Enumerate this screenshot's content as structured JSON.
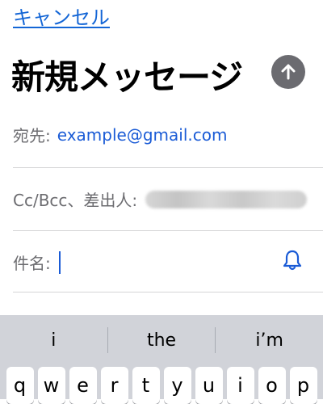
{
  "header": {
    "cancel_label": "キャンセル",
    "title": "新規メッセージ"
  },
  "fields": {
    "to_label": "宛先:",
    "to_value": "example@gmail.com",
    "cc_label": "Cc/Bcc、差出人:",
    "subject_label": "件名:"
  },
  "keyboard": {
    "suggestions": [
      "i",
      "the",
      "i’m"
    ],
    "keys": [
      "q",
      "w",
      "e",
      "r",
      "t",
      "y",
      "u",
      "i",
      "o",
      "p"
    ]
  },
  "colors": {
    "accent": "#1466d6",
    "send_button": "#6b6b70",
    "keyboard_bg": "#d1d3d9"
  }
}
